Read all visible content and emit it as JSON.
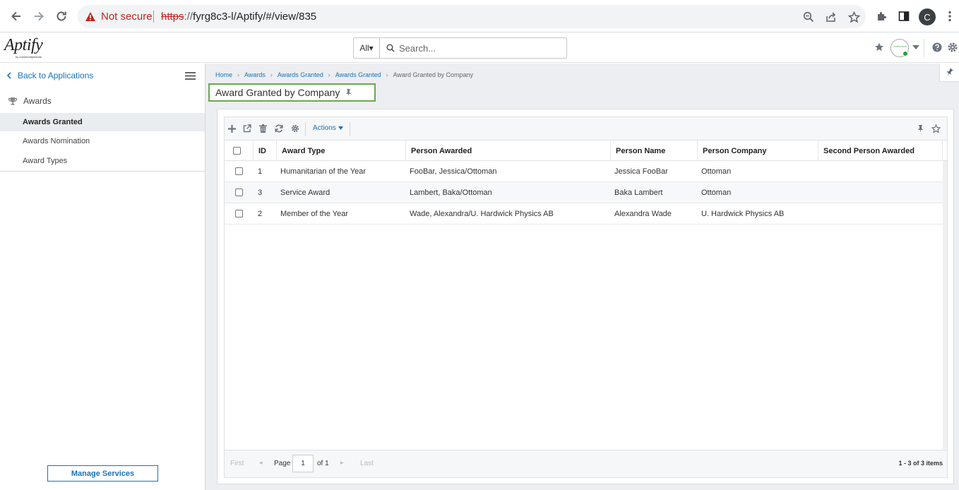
{
  "browser": {
    "security_label": "Not secure",
    "url_scheme": "https",
    "url_sep": "://",
    "url_host": "fyrg8c3-l",
    "url_path": "/Aptify/#/view/835",
    "profile_initial": "C"
  },
  "header": {
    "logo_text": "Aptify",
    "logo_sub": "by communitybrands",
    "search_scope": "All▾",
    "search_placeholder": "Search..."
  },
  "sidebar": {
    "back_label": "Back to Applications",
    "group_label": "Awards",
    "items": [
      {
        "label": "Awards Granted",
        "active": true
      },
      {
        "label": "Awards Nomination",
        "active": false
      },
      {
        "label": "Award Types",
        "active": false
      }
    ],
    "manage_services_label": "Manage Services"
  },
  "breadcrumb": {
    "items": [
      "Home",
      "Awards",
      "Awards Granted",
      "Awards Granted"
    ],
    "current": "Award Granted by Company"
  },
  "page_title": "Award Granted by Company",
  "toolbar": {
    "actions_label": "Actions"
  },
  "grid": {
    "columns": [
      "ID",
      "Award Type",
      "Person Awarded",
      "Person Name",
      "Person Company",
      "Second Person Awarded"
    ],
    "rows": [
      {
        "id": "1",
        "award_type": "Humanitarian of the Year",
        "person_awarded": "FooBar, Jessica/Ottoman",
        "person_name": "Jessica FooBar",
        "person_company": "Ottoman",
        "second_person": ""
      },
      {
        "id": "3",
        "award_type": "Service Award",
        "person_awarded": "Lambert, Baka/Ottoman",
        "person_name": "Baka Lambert",
        "person_company": "Ottoman",
        "second_person": ""
      },
      {
        "id": "2",
        "award_type": "Member of the Year",
        "person_awarded": "Wade, Alexandra/U. Hardwick Physics AB",
        "person_name": "Alexandra Wade",
        "person_company": "U. Hardwick Physics AB",
        "second_person": ""
      }
    ]
  },
  "pager": {
    "first_label": "First",
    "last_label": "Last",
    "page_label": "Page",
    "page_value": "1",
    "of_label": "of 1",
    "count_label": "1 - 3 of 3 items"
  },
  "colors": {
    "accent": "#1a73b8",
    "title_border": "#6aa84f",
    "warning": "#c5221f"
  }
}
